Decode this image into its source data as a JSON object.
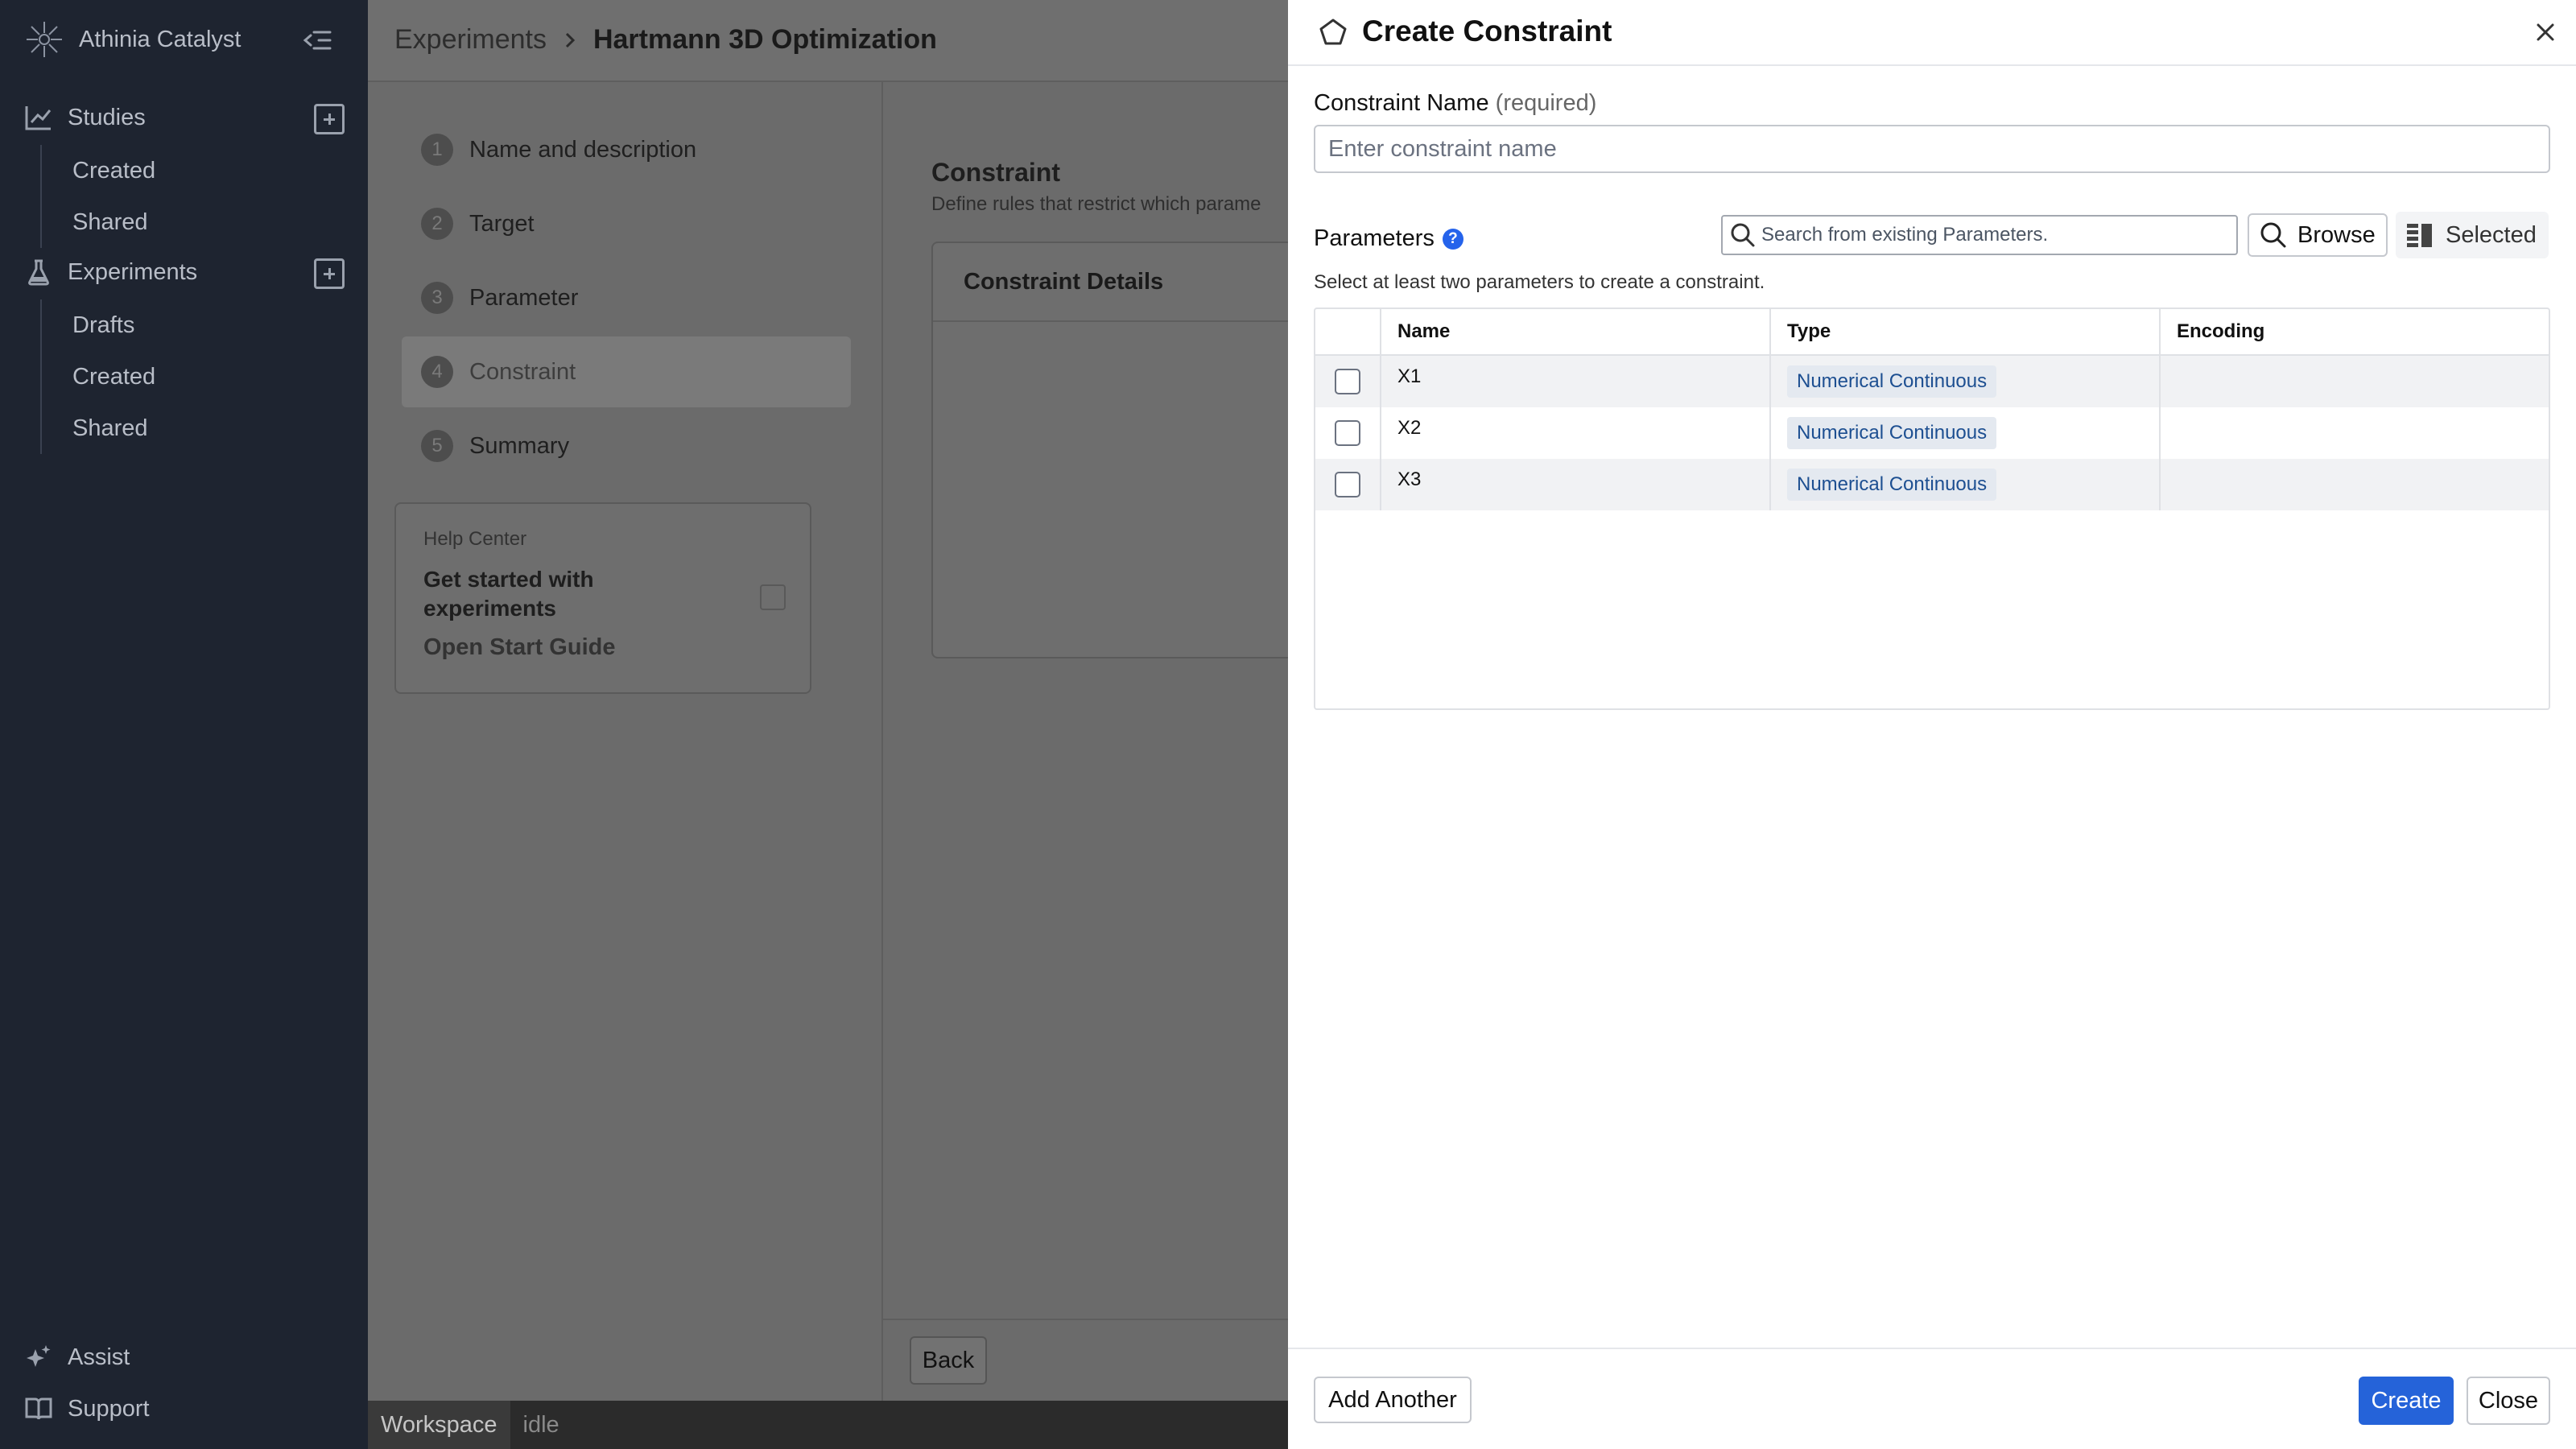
{
  "sidebar": {
    "app_name": "Athinia Catalyst",
    "studies": {
      "label": "Studies",
      "items": [
        "Created",
        "Shared"
      ]
    },
    "experiments": {
      "label": "Experiments",
      "items": [
        "Drafts",
        "Created",
        "Shared"
      ]
    },
    "assist_label": "Assist",
    "support_label": "Support"
  },
  "breadcrumb": {
    "parent": "Experiments",
    "current": "Hartmann 3D Optimization"
  },
  "steps": [
    {
      "num": "1",
      "label": "Name and description"
    },
    {
      "num": "2",
      "label": "Target"
    },
    {
      "num": "3",
      "label": "Parameter"
    },
    {
      "num": "4",
      "label": "Constraint",
      "active": true
    },
    {
      "num": "5",
      "label": "Summary"
    }
  ],
  "help": {
    "label": "Help Center",
    "title": "Get started with experiments",
    "link": "Open Start Guide"
  },
  "constraint_section": {
    "title": "Constraint",
    "description": "Define rules that restrict which parame",
    "card_title": "Constraint Details"
  },
  "back_label": "Back",
  "statusbar": {
    "workspace": "Workspace",
    "status": "idle"
  },
  "drawer": {
    "title": "Create Constraint",
    "name_label": "Constraint Name",
    "name_required": "(required)",
    "name_placeholder": "Enter constraint name",
    "params_label": "Parameters",
    "help_glyph": "?",
    "search_placeholder": "Search from existing Parameters.",
    "browse_label": "Browse",
    "selected_label": "Selected",
    "hint": "Select at least two parameters to create a constraint.",
    "columns": [
      "Name",
      "Type",
      "Encoding"
    ],
    "rows": [
      {
        "name": "X1",
        "type": "Numerical Continuous",
        "encoding": ""
      },
      {
        "name": "X2",
        "type": "Numerical Continuous",
        "encoding": ""
      },
      {
        "name": "X3",
        "type": "Numerical Continuous",
        "encoding": ""
      }
    ],
    "add_another_label": "Add Another",
    "create_label": "Create",
    "close_label": "Close"
  },
  "colors": {
    "accent": "#2563d9",
    "sidebar_bg": "#1e2430",
    "overlay": "#6b6b6b"
  }
}
